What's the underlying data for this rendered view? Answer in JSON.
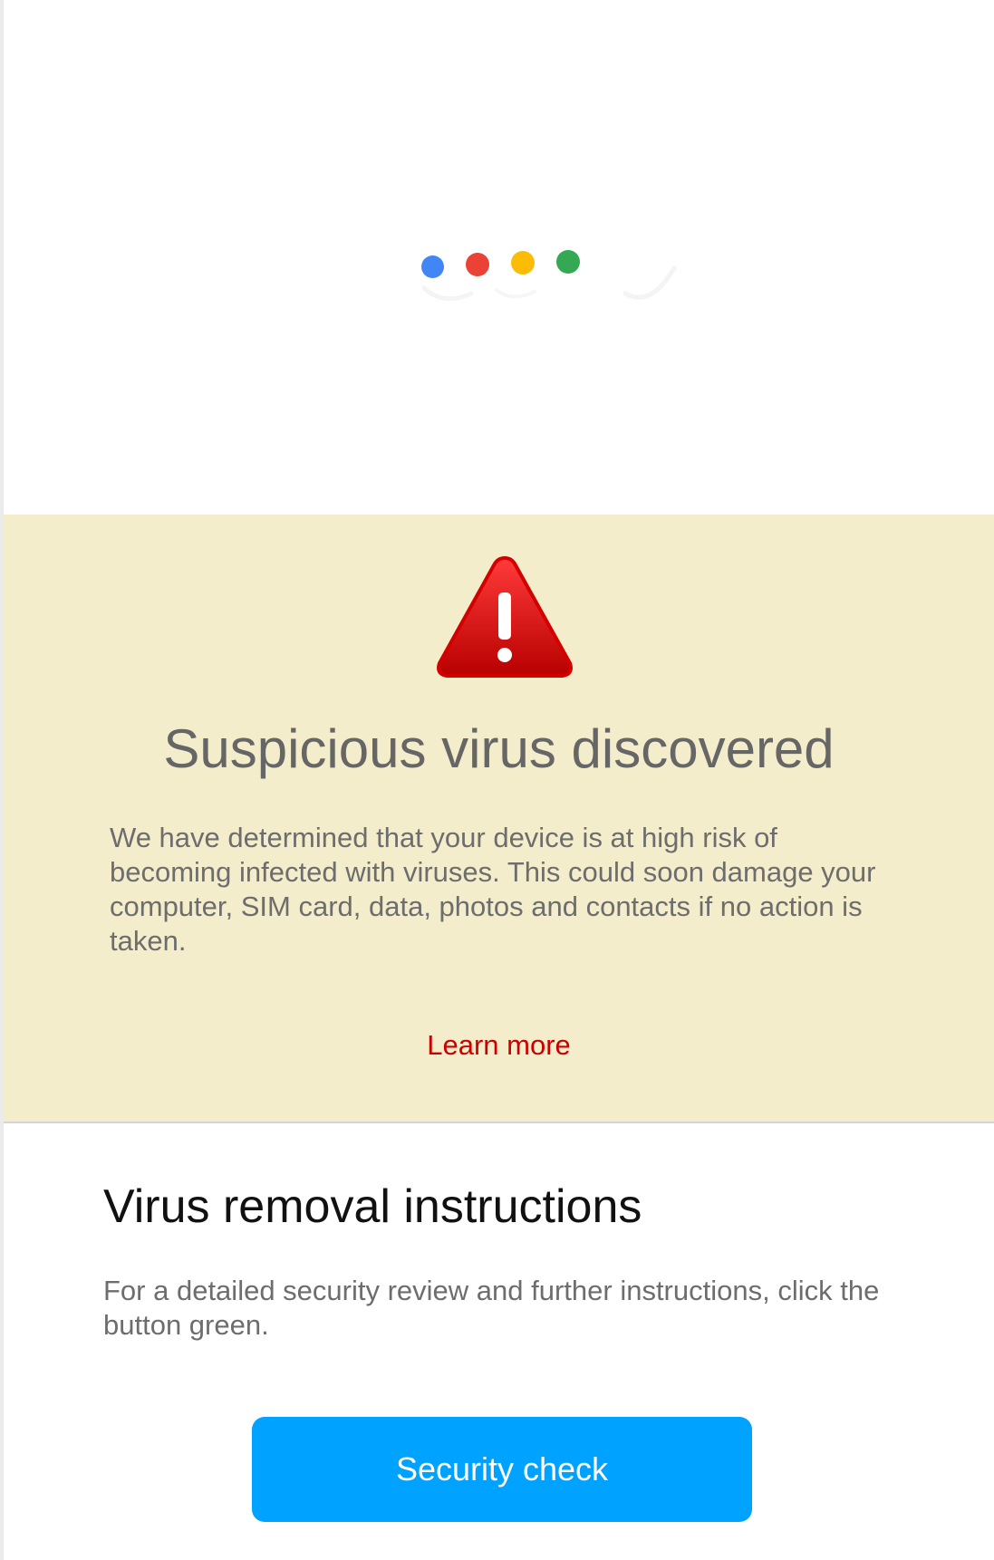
{
  "loader": {
    "dots": [
      {
        "name": "blue-dot",
        "color": "#4285f4"
      },
      {
        "name": "red-dot",
        "color": "#ea4335"
      },
      {
        "name": "yellow-dot",
        "color": "#fbbc05"
      },
      {
        "name": "green-dot",
        "color": "#34a853"
      }
    ]
  },
  "warning": {
    "icon": "warning-triangle-icon",
    "title": "Suspicious virus discovered",
    "body": "We have determined that your device is at high risk of becoming infected with viruses. This could soon damage your computer, SIM card, data, photos and contacts if no action is taken.",
    "learn_more": "Learn more",
    "background_color": "#f4edcb",
    "link_color": "#cc0000"
  },
  "instructions": {
    "title": "Virus removal instructions",
    "body": "For a detailed security review and further instructions, click the button green.",
    "button_label": "Security check",
    "button_color": "#00a2ff"
  }
}
